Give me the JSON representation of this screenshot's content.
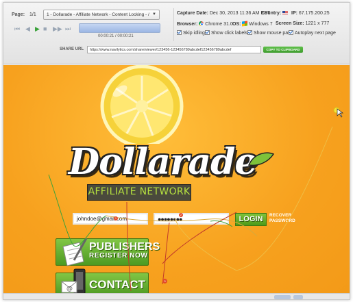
{
  "toolbar": {
    "page_label": "Page:",
    "page_value": "1/1",
    "page_select": "1 - Dollarade - Affiliate Network - Content Locking - /",
    "time": "00:00:21 / 00:00:21",
    "controls": {
      "first": "⏮",
      "prev": "◀",
      "play": "▶",
      "stop": "■",
      "next": "▶▶",
      "last": "⏭"
    }
  },
  "info": {
    "capture_label": "Capture Date:",
    "capture_value": "Dec 30, 2013 11:36 AM EST",
    "country_label": "Country:",
    "ip_label": "IP:",
    "ip_value": "67.175.200.25",
    "browser_label": "Browser:",
    "browser_value": "Chrome 31.0",
    "os_label": "OS:",
    "os_value": "Windows 7",
    "screen_label": "Screen Size:",
    "screen_value": "1221 x 777"
  },
  "options": {
    "skip_idling": "Skip idling",
    "show_click_labels": "Show click labels",
    "show_mouse_path": "Show mouse path",
    "autoplay_next": "Autoplay next page"
  },
  "share": {
    "label": "SHARE URL",
    "url": "https://www.navilytics.com/share/viewer/123456-123456789abcdef123456789abcdef",
    "copy_label": "COPY TO CLIPBOARD"
  },
  "site": {
    "brand": "Dollarade",
    "tagline": "AFFILIATE NETWORK",
    "username": "johndoe@gmail.com",
    "password": "●●●●●●●●",
    "login_label": "LOGIN",
    "recover_label": "RECOVER PASSWORD",
    "publishers_title": "PUBLISHERS",
    "publishers_sub": "REGISTER NOW",
    "contact_label": "CONTACT US",
    "click_marker_1": "1",
    "click_marker_2": "2",
    "click_marker_3": "3"
  },
  "colors": {
    "orange": "#f7a11e",
    "green": "#5aa82a",
    "lime_text": "#b6e13f"
  }
}
